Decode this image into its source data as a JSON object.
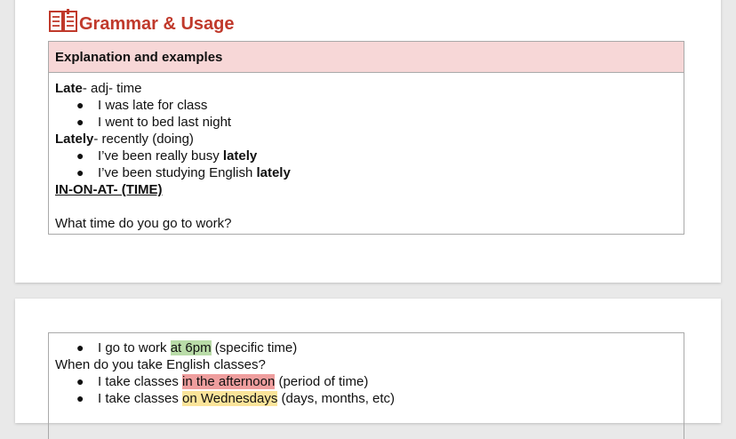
{
  "section": {
    "title": "Grammar & Usage",
    "icon": "book-icon",
    "accent_color": "#c0392b"
  },
  "table1": {
    "header": "Explanation and examples",
    "late_word": "Late",
    "late_def": "- adj- time",
    "late_ex1": "I was late for class",
    "late_ex2": "I went to bed last night",
    "lately_word": "Lately",
    "lately_def": "- recently (doing)",
    "lately_ex1_pre": "I’ve been really busy ",
    "lately_ex1_bold": "lately",
    "lately_ex2_pre": "I’ve been studying English ",
    "lately_ex2_bold": "lately",
    "heading_in_on_at": "IN-ON-AT- (TIME)",
    "question": "What time do you go to work?"
  },
  "table2": {
    "ex1_pre": "I go to work ",
    "ex1_hl": "at 6pm",
    "ex1_post": " (specific time)",
    "question": "When do you take English classes?",
    "ex2_pre": "I take classes ",
    "ex2_hl": "in the afternoon",
    "ex2_post": " (period of time)",
    "ex3_pre": "I take classes ",
    "ex3_hl": "on Wednesdays",
    "ex3_post": " (days, months, etc)"
  },
  "highlight_colors": {
    "green": "#b9dca8",
    "pink": "#ef9e9e",
    "yellow": "#fbe49a"
  }
}
